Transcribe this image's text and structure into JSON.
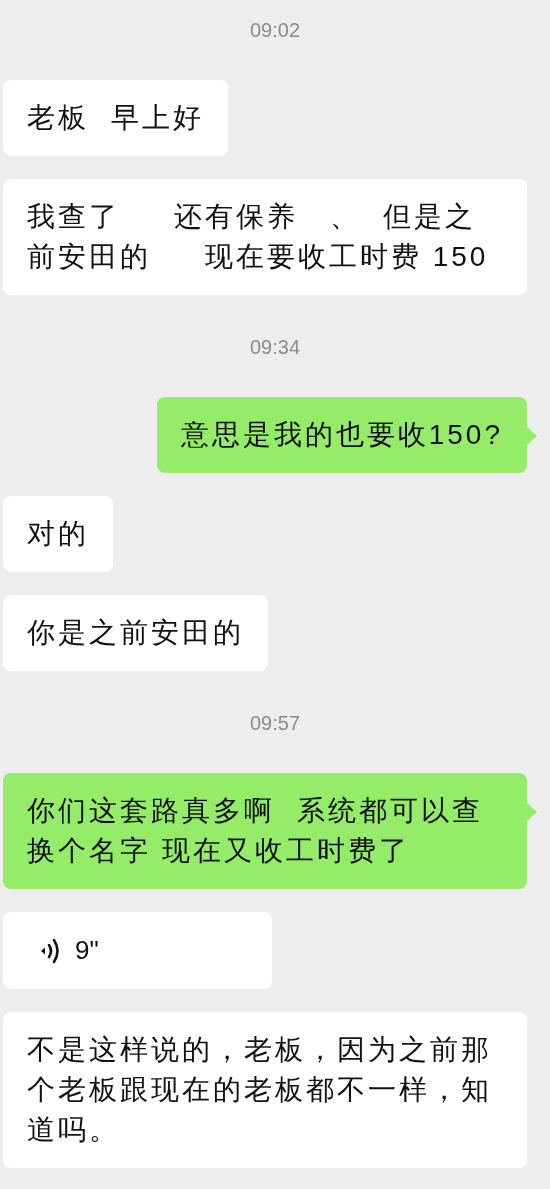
{
  "messages": [
    {
      "kind": "time",
      "text": "09:02"
    },
    {
      "kind": "text",
      "sent": false,
      "text": "老板  早上好"
    },
    {
      "kind": "text",
      "sent": false,
      "text": "我查了     还有保养   、  但是之前安田的     现在要收工时费 150"
    },
    {
      "kind": "time",
      "text": "09:34"
    },
    {
      "kind": "text",
      "sent": true,
      "text": "意思是我的也要收150?"
    },
    {
      "kind": "text",
      "sent": false,
      "text": "对的"
    },
    {
      "kind": "text",
      "sent": false,
      "text": "你是之前安田的"
    },
    {
      "kind": "time",
      "text": "09:57"
    },
    {
      "kind": "text",
      "sent": true,
      "text": "你们这套路真多啊  系统都可以查换个名字 现在又收工时费了"
    },
    {
      "kind": "voice",
      "sent": false,
      "duration": "9\""
    },
    {
      "kind": "text",
      "sent": false,
      "text": "不是这样说的，老板，因为之前那个老板跟现在的老板都不一样，知道吗。"
    }
  ]
}
